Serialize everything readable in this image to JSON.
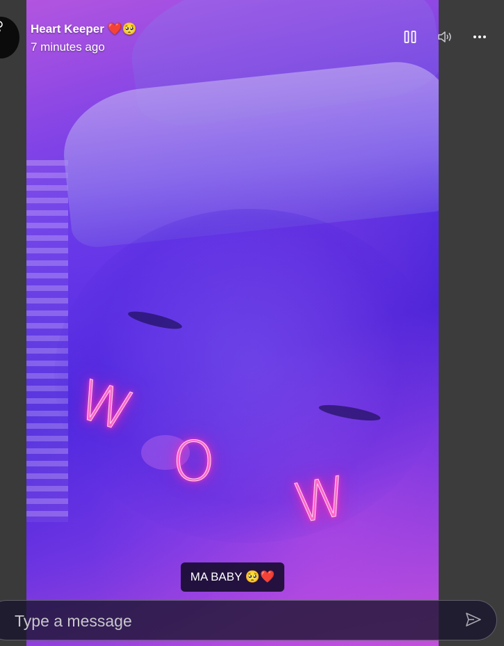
{
  "story": {
    "sender_name": "Heart Keeper ❤️🥺",
    "timestamp": "7 minutes ago",
    "image_text": [
      "W",
      "O",
      "W"
    ],
    "caption": "MA BABY 🥺❤️"
  },
  "controls": {
    "pause_icon": "pause-icon",
    "volume_icon": "volume-icon",
    "more_icon": "more-options-icon",
    "send_icon": "send-icon"
  },
  "composer": {
    "placeholder": "Type a message",
    "value": ""
  },
  "colors": {
    "background": "#3b3b3b",
    "neon": "#ff67c9",
    "caption_bg": "#120a28"
  }
}
